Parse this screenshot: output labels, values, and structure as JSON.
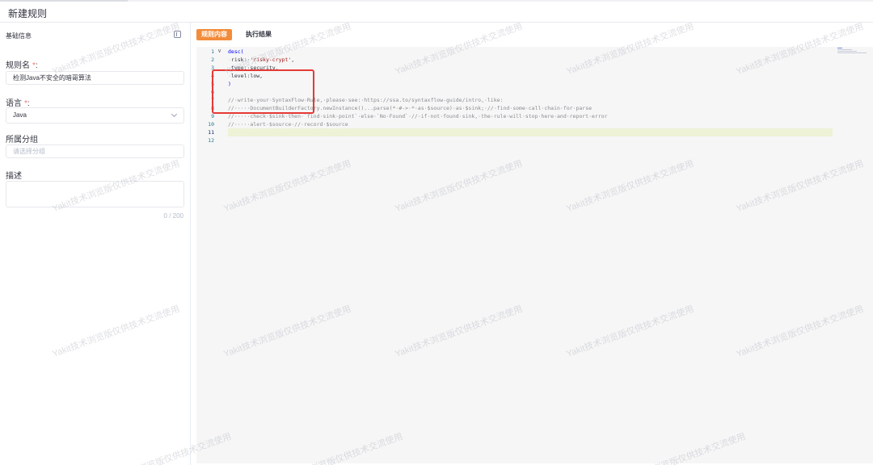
{
  "header": {
    "title": "新建规则"
  },
  "left_panel": {
    "section_title": "基础信息",
    "rule_name": {
      "label": "规则名",
      "required_mark": "*",
      "colon": ":",
      "value": "检测Java不安全的暗哥算法"
    },
    "language": {
      "label": "语言",
      "required_mark": "*",
      "colon": ":",
      "value": "Java"
    },
    "group": {
      "label": "所属分组",
      "placeholder": "请选择分组"
    },
    "description": {
      "label": "描述",
      "counter": "0 / 200"
    }
  },
  "tabs": [
    {
      "label": "规则内容",
      "active": true
    },
    {
      "label": "执行结果",
      "active": false
    }
  ],
  "editor": {
    "line_numbers": [
      "1",
      "2",
      "3",
      "4",
      "5",
      "6",
      "7",
      "8",
      "9",
      "10",
      "11",
      "12"
    ],
    "lines": {
      "l1_a": "desc(",
      "l2_ws": "·",
      "l2_a": "risk:·",
      "l2_s": "'risky-crypt'",
      "l2_b": ",",
      "l3_ws": "·",
      "l3_a": "type:·security,",
      "l4_ws": "·",
      "l4_a": "level:low,",
      "l5_a": ")",
      "l7": "//·write·your·SyntaxFlow·Rule,·please·see:·https://ssa.to/syntaxflow-guide/intro,·like:",
      "l8": "//·····DocumentBuilderFactory.newInstance()...parse(*·#->·*·as·$source)·as·$sink;·//·find·some·call·chain·for·parse",
      "l9": "//·····check·$sink·then·`find·sink·point`·else·`No·Found`·//·if·not·found·sink,·the·rule·will·stop·here·and·report·error",
      "l10": "//·····alert·$source·//·record·$source"
    }
  },
  "watermark": "Yakit技术浏览版仅供技术交流使用"
}
